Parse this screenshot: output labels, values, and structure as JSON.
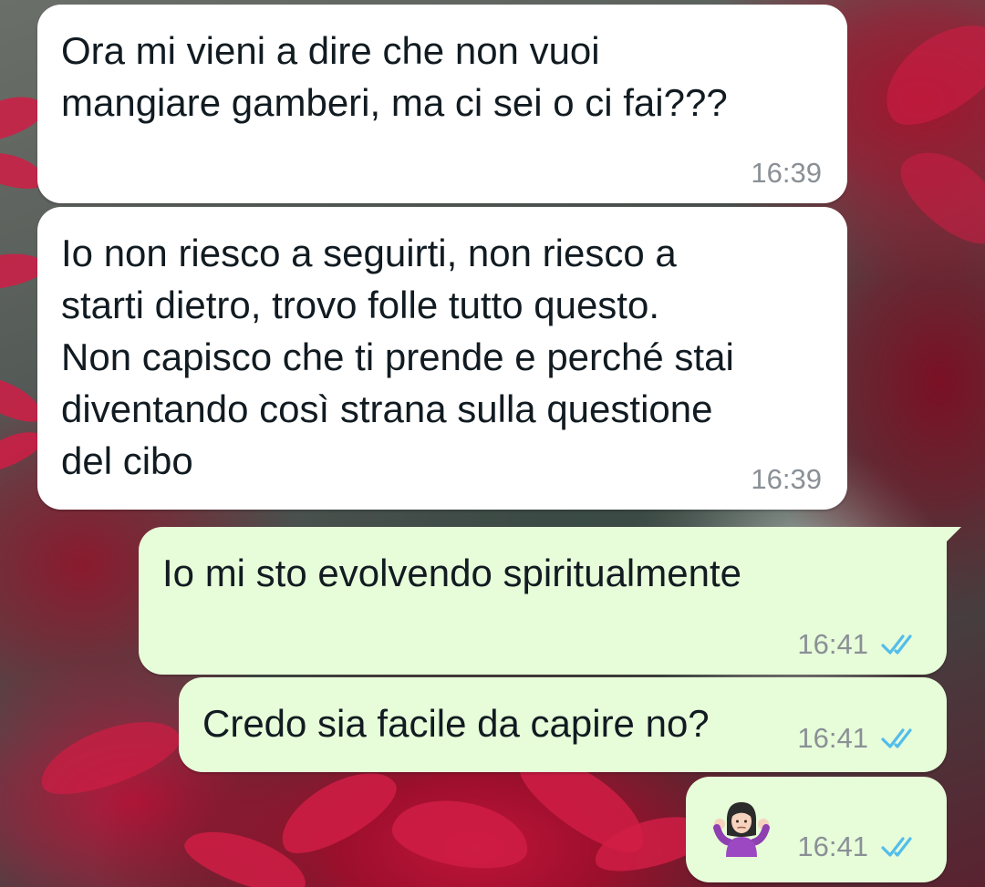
{
  "messages": [
    {
      "direction": "incoming",
      "text": "Ora mi vieni a dire che non vuoi\nmangiare gamberi, ma ci sei o ci fai???",
      "time": "16:39"
    },
    {
      "direction": "incoming",
      "text": "Io non riesco a seguirti, non riesco a\nstarti dietro, trovo folle tutto questo.\nNon capisco che ti prende e perché stai\ndiventando così strana sulla questione\ndel cibo",
      "time": "16:39"
    },
    {
      "direction": "outgoing",
      "text": "Io mi sto evolvendo spiritualmente",
      "time": "16:41",
      "status": "read"
    },
    {
      "direction": "outgoing",
      "text": "Credo sia facile da capire no?",
      "time": "16:41",
      "status": "read"
    },
    {
      "direction": "outgoing",
      "emoji": "person-shrugging-emoji",
      "time": "16:41",
      "status": "read"
    }
  ],
  "colors": {
    "incoming_bubble": "#ffffff",
    "outgoing_bubble": "#e7fcd9",
    "timestamp": "#8a9096",
    "read_ticks": "#53bdeb",
    "text": "#111b21"
  },
  "icons": {
    "read_status": "double-check-icon"
  }
}
